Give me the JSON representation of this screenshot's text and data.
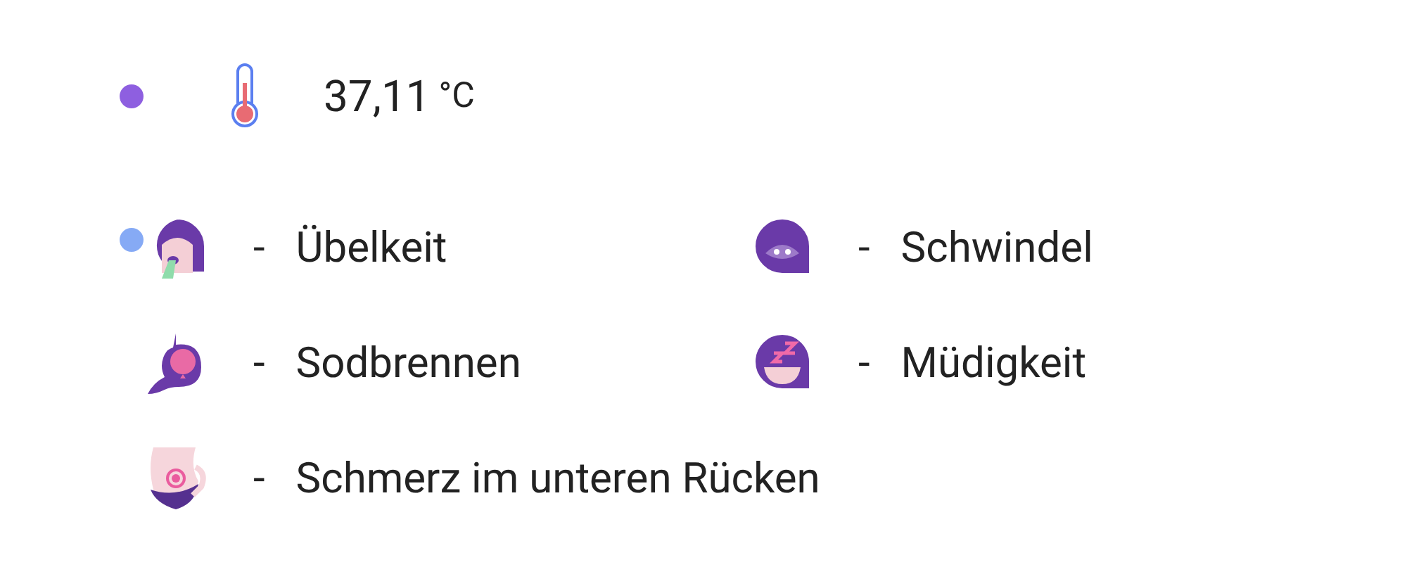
{
  "temperature": {
    "color": "#8e5fe0",
    "value": "37,11",
    "unit": "°C"
  },
  "symptoms_group": {
    "color": "#86aaf5",
    "items": [
      {
        "kind": "nausea",
        "dash": "-",
        "label": "Übelkeit"
      },
      {
        "kind": "dizziness",
        "dash": "-",
        "label": "Schwindel"
      },
      {
        "kind": "heartburn",
        "dash": "-",
        "label": "Sodbrennen"
      },
      {
        "kind": "fatigue",
        "dash": "-",
        "label": "Müdigkeit"
      },
      {
        "kind": "back_pain",
        "dash": "-",
        "label": "Schmerz im unteren Rücken"
      }
    ]
  }
}
